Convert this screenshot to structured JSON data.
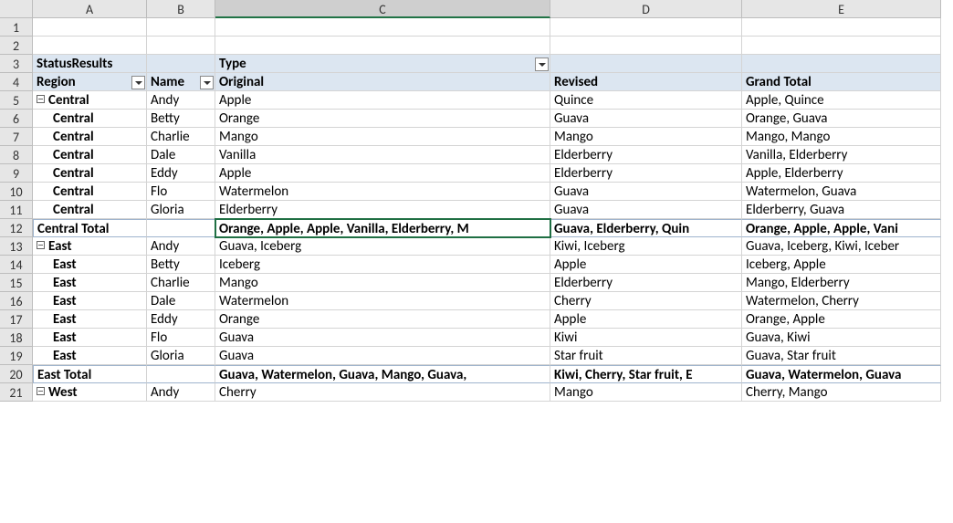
{
  "columns": [
    "A",
    "B",
    "C",
    "D",
    "E"
  ],
  "rowNumbers": [
    "1",
    "2",
    "3",
    "4",
    "5",
    "6",
    "7",
    "8",
    "9",
    "10",
    "11",
    "12",
    "13",
    "14",
    "15",
    "16",
    "17",
    "18",
    "19",
    "20",
    "21"
  ],
  "row3": {
    "A": "StatusResults",
    "C": "Type"
  },
  "row4": {
    "A": "Region",
    "B": "Name",
    "C": "Original",
    "D": "Revised",
    "E": "Grand Total"
  },
  "rows": [
    {
      "num": "5",
      "A": "Central",
      "collapse": true,
      "B": "Andy",
      "C": "Apple",
      "D": "Quince",
      "E": "Apple, Quince"
    },
    {
      "num": "6",
      "A": "Central",
      "B": "Betty",
      "C": "Orange",
      "D": "Guava",
      "E": "Orange, Guava"
    },
    {
      "num": "7",
      "A": "Central",
      "B": "Charlie",
      "C": "Mango",
      "D": "Mango",
      "E": "Mango, Mango"
    },
    {
      "num": "8",
      "A": "Central",
      "B": "Dale",
      "C": "Vanilla",
      "D": "Elderberry",
      "E": "Vanilla, Elderberry"
    },
    {
      "num": "9",
      "A": "Central",
      "B": "Eddy",
      "C": "Apple",
      "D": "Elderberry",
      "E": "Apple, Elderberry"
    },
    {
      "num": "10",
      "A": "Central",
      "B": "Flo",
      "C": "Watermelon",
      "D": "Guava",
      "E": "Watermelon, Guava"
    },
    {
      "num": "11",
      "A": "Central",
      "B": "Gloria",
      "C": "Elderberry",
      "D": "Guava",
      "E": "Elderberry, Guava"
    }
  ],
  "centralTotal": {
    "num": "12",
    "A": "Central Total",
    "C": "Orange, Apple, Apple, Vanilla, Elderberry, M",
    "D": "Guava, Elderberry, Quin",
    "E": "Orange, Apple, Apple, Vani"
  },
  "eastRows": [
    {
      "num": "13",
      "A": "East",
      "collapse": true,
      "B": "Andy",
      "C": "Guava, Iceberg",
      "D": "Kiwi, Iceberg",
      "E": "Guava, Iceberg, Kiwi, Iceber"
    },
    {
      "num": "14",
      "A": "East",
      "B": "Betty",
      "C": "Iceberg",
      "D": "Apple",
      "E": "Iceberg, Apple"
    },
    {
      "num": "15",
      "A": "East",
      "B": "Charlie",
      "C": "Mango",
      "D": "Elderberry",
      "E": "Mango, Elderberry"
    },
    {
      "num": "16",
      "A": "East",
      "B": "Dale",
      "C": "Watermelon",
      "D": "Cherry",
      "E": "Watermelon, Cherry"
    },
    {
      "num": "17",
      "A": "East",
      "B": "Eddy",
      "C": "Orange",
      "D": "Apple",
      "E": "Orange, Apple"
    },
    {
      "num": "18",
      "A": "East",
      "B": "Flo",
      "C": "Guava",
      "D": "Kiwi",
      "E": "Guava, Kiwi"
    },
    {
      "num": "19",
      "A": "East",
      "B": "Gloria",
      "C": "Guava",
      "D": "Star fruit",
      "E": "Guava, Star fruit"
    }
  ],
  "eastTotal": {
    "num": "20",
    "A": "East Total",
    "C": "Guava, Watermelon, Guava, Mango, Guava,",
    "D": "Kiwi, Cherry, Star fruit, E",
    "E": "Guava, Watermelon, Guava"
  },
  "westRow": {
    "num": "21",
    "A": "West",
    "collapse": true,
    "B": "Andy",
    "C": "Cherry",
    "D": "Mango",
    "E": "Cherry, Mango"
  }
}
